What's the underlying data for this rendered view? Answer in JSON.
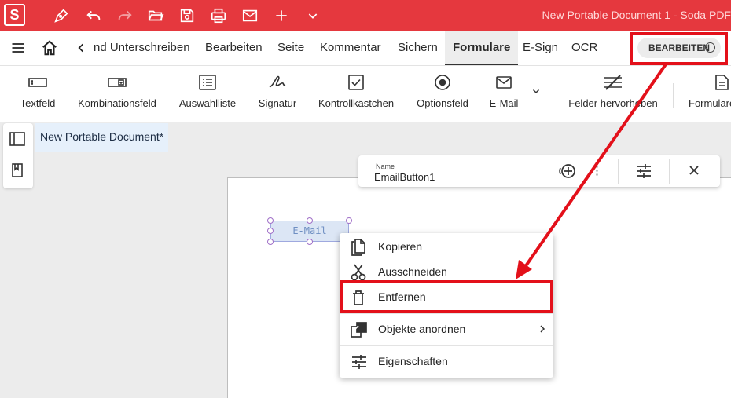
{
  "titlebar": {
    "logo_letter": "S",
    "window_title": "New Portable Document 1   -   Soda PDF"
  },
  "menubar": {
    "tabs": [
      {
        "label": "nd Unterschreiben"
      },
      {
        "label": "Bearbeiten"
      },
      {
        "label": "Seite"
      },
      {
        "label": "Kommentar"
      },
      {
        "label": "Sichern"
      },
      {
        "label": "Formulare",
        "active": true
      },
      {
        "label": "E-Sign"
      },
      {
        "label": "OCR"
      }
    ],
    "edit_toggle_label": "BEARBEITEN"
  },
  "ribbon": {
    "buttons": [
      {
        "label": "Textfeld",
        "icon": "textfield-icon"
      },
      {
        "label": "Kombinationsfeld",
        "icon": "combobox-icon"
      },
      {
        "label": "Auswahlliste",
        "icon": "listbox-icon"
      },
      {
        "label": "Signatur",
        "icon": "signature-icon"
      },
      {
        "label": "Kontrollkästchen",
        "icon": "checkbox-icon"
      },
      {
        "label": "Optionsfeld",
        "icon": "radio-icon"
      },
      {
        "label": "E-Mail",
        "icon": "email-icon"
      },
      {
        "label": "Felder hervorheben",
        "icon": "highlight-fields-icon"
      },
      {
        "label": "Formulare",
        "icon": "form-document-icon"
      }
    ]
  },
  "document": {
    "tab_title": "New Portable Document*",
    "field_text": "E-Mail"
  },
  "property_bar": {
    "name_label": "Name",
    "name_value": "EmailButton1"
  },
  "context_menu": {
    "items": [
      {
        "label": "Kopieren",
        "icon": "copy-icon"
      },
      {
        "label": "Ausschneiden",
        "icon": "scissors-icon"
      },
      {
        "label": "Entfernen",
        "icon": "trash-icon"
      },
      {
        "label": "Objekte anordnen",
        "icon": "arrange-icon"
      },
      {
        "label": "Eigenschaften",
        "icon": "properties-icon"
      }
    ]
  },
  "colors": {
    "brand_red": "#e5383e",
    "annotation_red": "#e3101a"
  }
}
